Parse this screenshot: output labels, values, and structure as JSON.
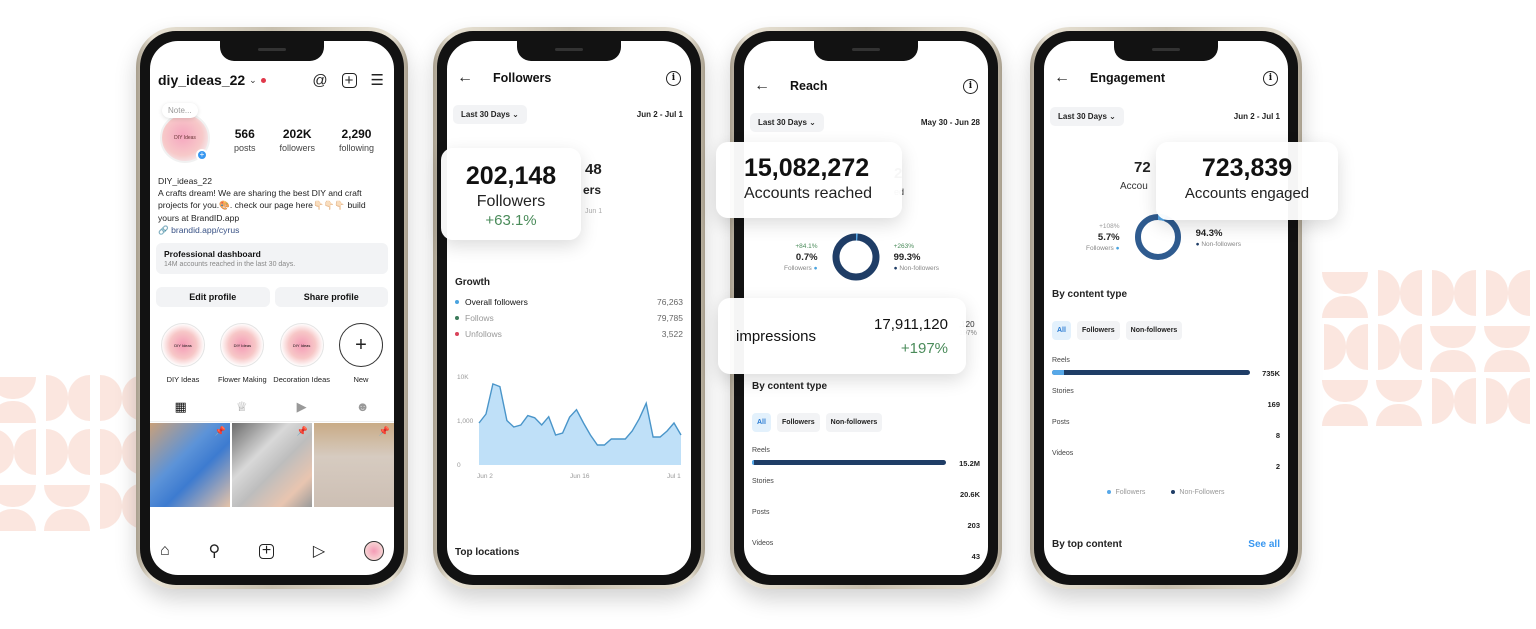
{
  "colors": {
    "accent_blue": "#3897f0",
    "dark_navy": "#1f3d66",
    "light_blue": "#57a8e8",
    "positive_green": "#4a8b5a",
    "unfollow_red": "#d9435a",
    "pattern_peach": "#fbe6df"
  },
  "profile": {
    "username": "diy_ideas_22",
    "note_placeholder": "Note...",
    "avatar_text": "DIY Ideas",
    "icons": [
      "threads-icon",
      "create-icon",
      "menu-icon"
    ],
    "stats": [
      {
        "value": "566",
        "label": "posts"
      },
      {
        "value": "202K",
        "label": "followers"
      },
      {
        "value": "2,290",
        "label": "following"
      }
    ],
    "bio_name": "DIY_ideas_22",
    "bio_text": "A crafts dream! We are sharing the best DIY and craft projects for you.🎨. check our page here👇🏻👇🏻👇🏻 build yours at BrandID.app",
    "bio_link": "brandid.app/cyrus",
    "dashboard_title": "Professional dashboard",
    "dashboard_sub": "14M accounts reached in the last 30 days.",
    "edit_profile": "Edit profile",
    "share_profile": "Share profile",
    "highlights": [
      {
        "label": "DIY Ideas",
        "thumb": "DIY Ideas"
      },
      {
        "label": "Flower Making",
        "thumb": "DIY Ideas"
      },
      {
        "label": "Decoration Ideas",
        "thumb": "DIY Ideas"
      },
      {
        "label": "New",
        "thumb": "+"
      }
    ],
    "tabs": [
      "grid-icon",
      "crown-icon",
      "reels-icon",
      "tagged-icon"
    ],
    "bottom_nav": [
      "home-icon",
      "search-icon",
      "create-icon",
      "reels-icon",
      "profile-icon"
    ]
  },
  "followers": {
    "title": "Followers",
    "range": "Last 30 Days",
    "dates": "Jun 2 - Jul 1",
    "ghost_value": "48",
    "ghost_label": "ers",
    "ghost_date": "Jun 1",
    "callout": {
      "value": "202,148",
      "label": "Followers",
      "change": "+63.1%"
    },
    "growth_title": "Growth",
    "growth": [
      {
        "label": "Overall followers",
        "value": "76,263",
        "color": "#4aa3df"
      },
      {
        "label": "Follows",
        "value": "79,785",
        "color": "#3c7a5a"
      },
      {
        "label": "Unfollows",
        "value": "3,522",
        "color": "#d9435a"
      }
    ],
    "top_locations": "Top locations"
  },
  "chart_data": {
    "type": "area",
    "title": "Growth",
    "xlabel": "",
    "ylabel": "",
    "x_ticks": [
      "Jun 2",
      "Jun 16",
      "Jul 1"
    ],
    "y_ticks": [
      "0",
      "1,000",
      "10K"
    ],
    "ylim": [
      0,
      10000
    ],
    "grid": false,
    "series": [
      {
        "name": "Overall followers",
        "values": [
          2100,
          3500,
          9100,
          8600,
          2300,
          1900,
          2000,
          3200,
          2800,
          2000,
          3000,
          1500,
          1600,
          2900,
          4300,
          2100,
          1500,
          1000,
          1000,
          1300,
          1300,
          1300,
          1700,
          2600,
          5500,
          1400,
          1400,
          1700,
          2100,
          1500
        ]
      }
    ]
  },
  "reach": {
    "title": "Reach",
    "range": "Last 30 Days",
    "dates": "May 30 - Jun 28",
    "ghost_value": "2",
    "ghost_label": "ed",
    "callout": {
      "value": "15,082,272",
      "label": "Accounts reached"
    },
    "donut": {
      "left": {
        "change": "+84.1%",
        "value": "0.7%",
        "label": "Followers"
      },
      "right": {
        "change": "+263%",
        "value": "99.3%",
        "label": "Non-followers"
      },
      "followers_fraction": 0.007
    },
    "impressions_callout": {
      "label": "impressions",
      "value": "17,911,120",
      "change": "+197%"
    },
    "ghost_impr_value": ",120",
    "ghost_impr_change": "197%",
    "content_title": "By content type",
    "pills": [
      "All",
      "Followers",
      "Non-followers"
    ],
    "content": [
      {
        "label": "Reels",
        "value": "15.2M",
        "fraction": 1.0,
        "followers_fraction": 0.01
      },
      {
        "label": "Stories",
        "value": "20.6K",
        "fraction": 0.0,
        "followers_fraction": 0
      },
      {
        "label": "Posts",
        "value": "203",
        "fraction": 0.0,
        "followers_fraction": 0
      },
      {
        "label": "Videos",
        "value": "43",
        "fraction": 0.0,
        "followers_fraction": 0
      }
    ]
  },
  "engagement": {
    "title": "Engagement",
    "range": "Last 30 Days",
    "dates": "Jun 2 - Jul 1",
    "ghost_value": "72",
    "ghost_label": "Accou",
    "callout": {
      "value": "723,839",
      "label": "Accounts engaged"
    },
    "donut": {
      "left": {
        "change": "+108%",
        "value": "5.7%",
        "label": "Followers"
      },
      "right": {
        "change": "",
        "value": "94.3%",
        "label": "Non-followers"
      },
      "followers_fraction": 0.057
    },
    "content_title": "By content type",
    "pills": [
      "All",
      "Followers",
      "Non-followers"
    ],
    "content": [
      {
        "label": "Reels",
        "value": "735K",
        "fraction": 1.0,
        "followers_fraction": 0.06
      },
      {
        "label": "Stories",
        "value": "169",
        "fraction": 0.0,
        "followers_fraction": 0
      },
      {
        "label": "Posts",
        "value": "8",
        "fraction": 0.0,
        "followers_fraction": 0
      },
      {
        "label": "Videos",
        "value": "2",
        "fraction": 0.0,
        "followers_fraction": 0
      }
    ],
    "legend": [
      "Followers",
      "Non-Followers"
    ],
    "top_content": "By top content",
    "see_all": "See all"
  }
}
